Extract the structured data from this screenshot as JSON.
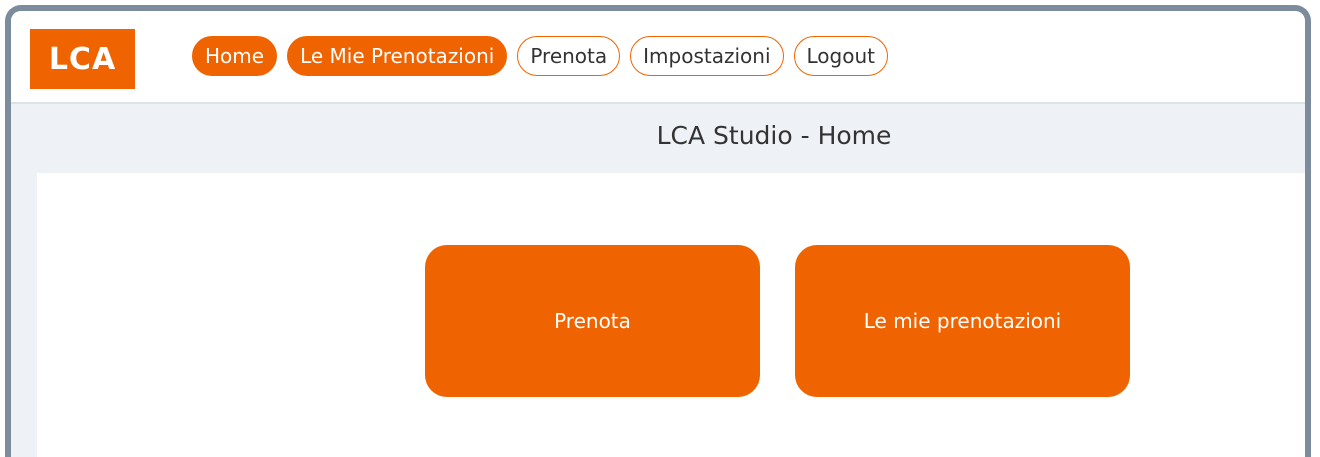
{
  "logo": {
    "text": "LCA"
  },
  "nav": {
    "items": [
      {
        "label": "Home"
      },
      {
        "label": "Le Mie Prenotazioni"
      },
      {
        "label": "Prenota"
      },
      {
        "label": "Impostazioni"
      },
      {
        "label": "Logout"
      }
    ]
  },
  "page": {
    "title": "LCA Studio - Home"
  },
  "tiles": [
    {
      "label": "Prenota"
    },
    {
      "label": "Le mie prenotazioni"
    }
  ],
  "colors": {
    "accent": "#ef6300",
    "frame": "#7d8c9c",
    "background": "#eef1f5"
  }
}
